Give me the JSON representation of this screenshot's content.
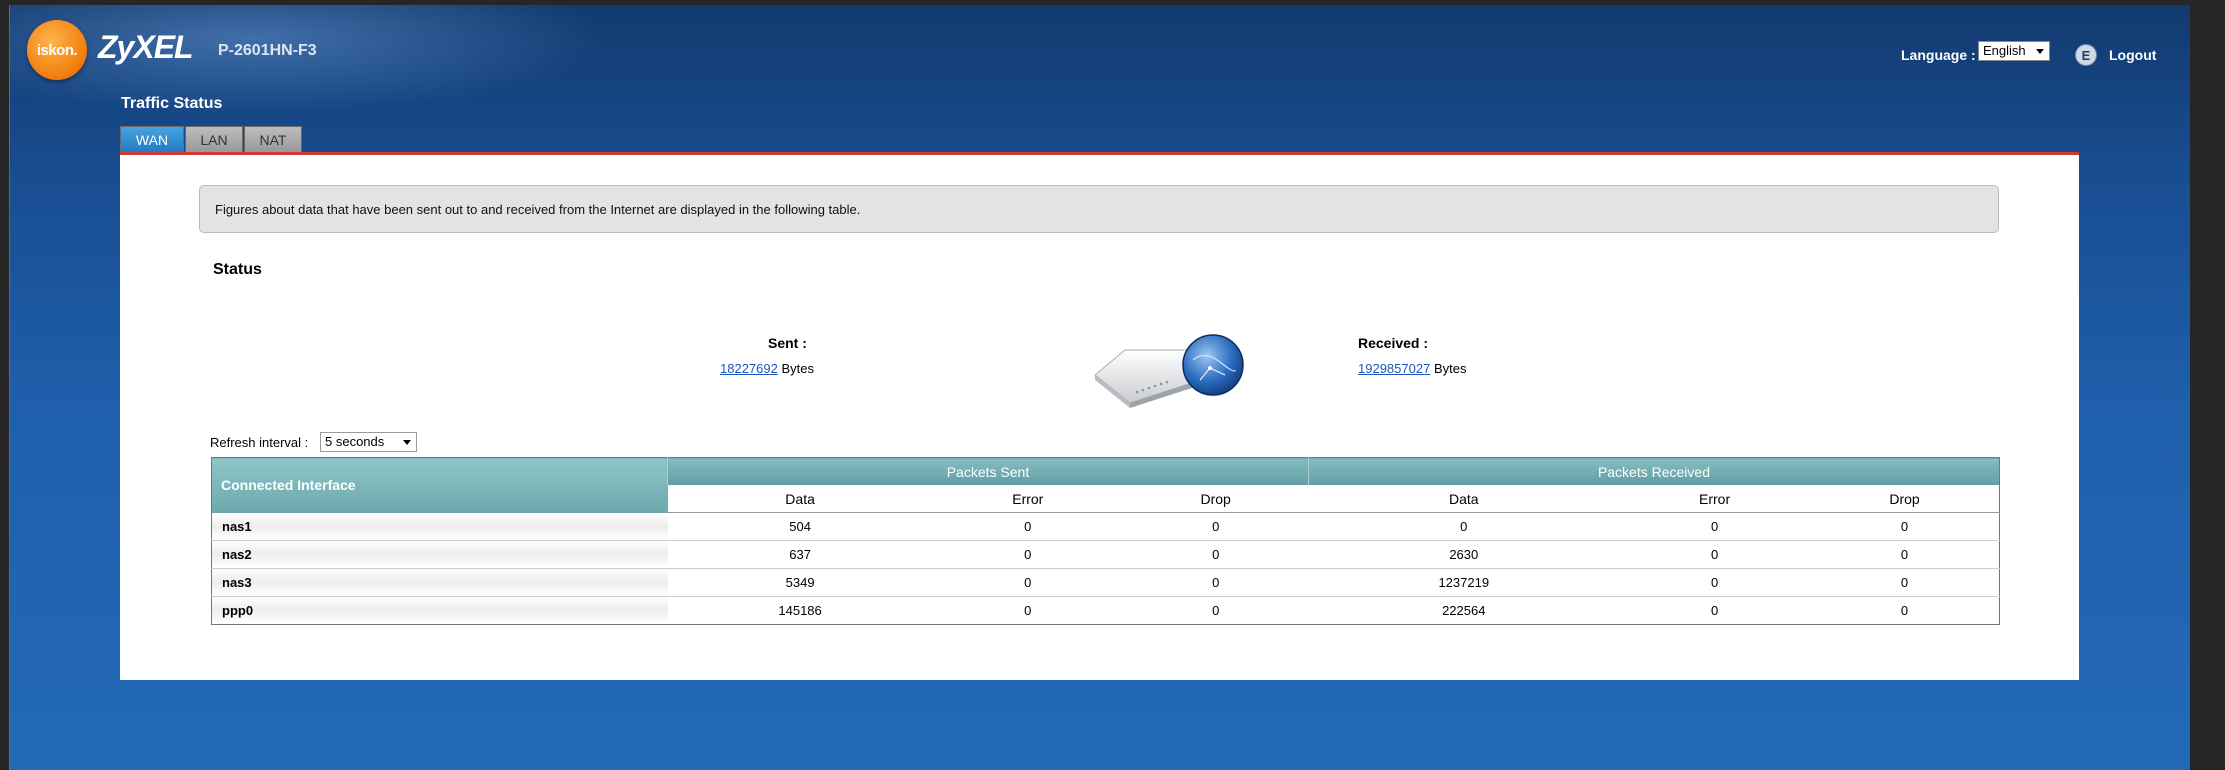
{
  "header": {
    "logo_text": "iskon.",
    "brand": "ZyXEL",
    "model": "P-2601HN-F3",
    "language_label": "Language :",
    "language_value": "English",
    "logout_label": "Logout"
  },
  "page": {
    "title": "Traffic Status",
    "tabs": [
      {
        "label": "WAN",
        "active": true
      },
      {
        "label": "LAN",
        "active": false
      },
      {
        "label": "NAT",
        "active": false
      }
    ]
  },
  "content": {
    "info_text": "Figures about data that have been sent out to and received from the Internet are displayed in the following table.",
    "status_heading": "Status",
    "sent_label": "Sent :",
    "sent_bytes": "18227692",
    "received_label": "Received :",
    "received_bytes": "1929857027",
    "bytes_unit": "Bytes",
    "refresh_label": "Refresh interval :",
    "refresh_value": "5 seconds"
  },
  "table": {
    "interface_header": "Connected Interface",
    "sent_header": "Packets Sent",
    "received_header": "Packets Received",
    "sub_headers": [
      "Data",
      "Error",
      "Drop",
      "Data",
      "Error",
      "Drop"
    ],
    "rows": [
      {
        "name": "nas1",
        "sent_data": "504",
        "sent_error": "0",
        "sent_drop": "0",
        "recv_data": "0",
        "recv_error": "0",
        "recv_drop": "0"
      },
      {
        "name": "nas2",
        "sent_data": "637",
        "sent_error": "0",
        "sent_drop": "0",
        "recv_data": "2630",
        "recv_error": "0",
        "recv_drop": "0"
      },
      {
        "name": "nas3",
        "sent_data": "5349",
        "sent_error": "0",
        "sent_drop": "0",
        "recv_data": "1237219",
        "recv_error": "0",
        "recv_drop": "0"
      },
      {
        "name": "ppp0",
        "sent_data": "145186",
        "sent_error": "0",
        "sent_drop": "0",
        "recv_data": "222564",
        "recv_error": "0",
        "recv_drop": "0"
      }
    ]
  },
  "colors": {
    "accent_tab": "#1f7cc4",
    "table_header": "#6ca8ad",
    "link": "#1a56c2",
    "separator_red": "#d23a3a"
  }
}
